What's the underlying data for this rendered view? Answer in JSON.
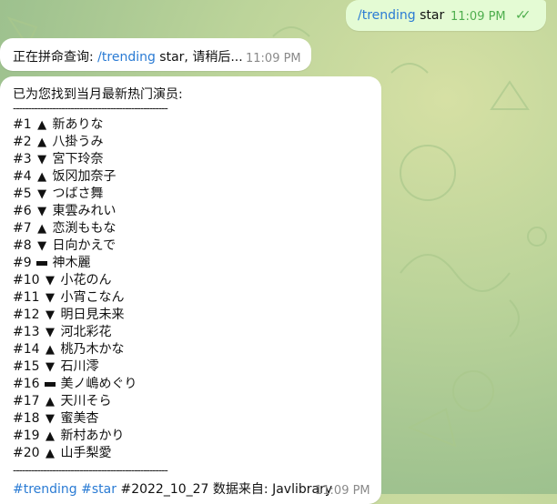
{
  "messages": {
    "query": {
      "command": "/trending",
      "text": " star",
      "time": "11:09 PM",
      "status_icon": "double-check-icon"
    },
    "searching": {
      "prefix": "正在拼命查询: ",
      "command": "/trending",
      "suffix": " star, 请稍后...",
      "time": "11:09 PM"
    },
    "result": {
      "header": "已为您找到当月最新热门演员:",
      "separator": "---------------------------------------------------",
      "items": [
        {
          "rank": "#1",
          "trend": "up",
          "symbol": "▲",
          "name": "新ありな"
        },
        {
          "rank": "#2",
          "trend": "up",
          "symbol": "▲",
          "name": "八掛うみ"
        },
        {
          "rank": "#3",
          "trend": "down",
          "symbol": "▼",
          "name": "宮下玲奈"
        },
        {
          "rank": "#4",
          "trend": "up",
          "symbol": "▲",
          "name": "饭冈加奈子"
        },
        {
          "rank": "#5",
          "trend": "down",
          "symbol": "▼",
          "name": "つばさ舞"
        },
        {
          "rank": "#6",
          "trend": "down",
          "symbol": "▼",
          "name": "東雲みれい"
        },
        {
          "rank": "#7",
          "trend": "up",
          "symbol": "▲",
          "name": "恋渕ももな"
        },
        {
          "rank": "#8",
          "trend": "down",
          "symbol": "▼",
          "name": "日向かえで"
        },
        {
          "rank": "#9",
          "trend": "same",
          "symbol": "▬",
          "name": "神木麗"
        },
        {
          "rank": "#10",
          "trend": "down",
          "symbol": "▼",
          "name": "小花のん"
        },
        {
          "rank": "#11",
          "trend": "down",
          "symbol": "▼",
          "name": "小宵こなん"
        },
        {
          "rank": "#12",
          "trend": "down",
          "symbol": "▼",
          "name": "明日見未来"
        },
        {
          "rank": "#13",
          "trend": "down",
          "symbol": "▼",
          "name": "河北彩花"
        },
        {
          "rank": "#14",
          "trend": "up",
          "symbol": "▲",
          "name": "桃乃木かな"
        },
        {
          "rank": "#15",
          "trend": "down",
          "symbol": "▼",
          "name": "石川澪"
        },
        {
          "rank": "#16",
          "trend": "same",
          "symbol": "▬",
          "name": "美ノ嶋めぐり"
        },
        {
          "rank": "#17",
          "trend": "up",
          "symbol": "▲",
          "name": "天川そら"
        },
        {
          "rank": "#18",
          "trend": "down",
          "symbol": "▼",
          "name": "蜜美杏"
        },
        {
          "rank": "#19",
          "trend": "up",
          "symbol": "▲",
          "name": "新村あかり"
        },
        {
          "rank": "#20",
          "trend": "up",
          "symbol": "▲",
          "name": "山手梨愛"
        }
      ],
      "footer": {
        "tag1": "#trending",
        "tag2": "#star",
        "text": " #2022_10_27 数据来自: Javlibrary"
      },
      "time": "11:09 PM"
    }
  },
  "colors": {
    "link": "#2a7bd4",
    "outgoing_bubble": "#e4fbd4",
    "incoming_bubble": "#ffffff",
    "check": "#4fae4e"
  }
}
